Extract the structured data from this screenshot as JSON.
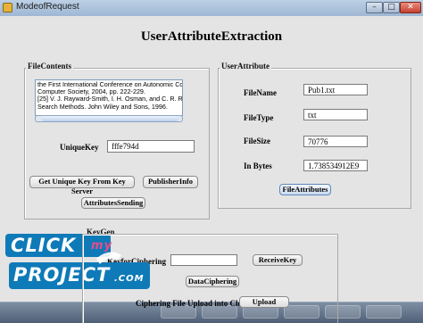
{
  "window": {
    "title": "ModeofRequest",
    "minimize": "–",
    "maximize": "□",
    "close": "✕"
  },
  "main_title": "UserAttributeExtraction",
  "file_contents": {
    "group_label": "FileContents",
    "text_lines": [
      "the First International Conference on Autonomic Computing",
      "Computer Society, 2004, pp. 222-229.",
      "[25] V. J. Rayward-Smith, I. H. Osman, and C. R. Reeves, M",
      "Search Methods. John Wiley and Sons, 1996."
    ],
    "unique_key_label": "UniqueKey",
    "unique_key_value": "fffe794d",
    "get_key_button": "Get Unique Key From Key Server",
    "publisher_info_button": "PublisherInfo",
    "attributes_sending_button": "AttributesSending"
  },
  "user_attribute": {
    "group_label": "UserAttribute",
    "file_name_label": "FileName",
    "file_name_value": "Pub1.txt",
    "file_type_label": "FileType",
    "file_type_value": "txt",
    "file_size_label": "FileSize",
    "file_size_value": "70776",
    "in_bytes_label": "In Bytes",
    "in_bytes_value": "1.738534912E9",
    "file_attributes_button": "FileAttributes"
  },
  "keygen": {
    "group_label": "KeyGen",
    "key_for_ciphering_label": "KeyforCiphering",
    "key_for_ciphering_value": "",
    "receive_key_button": "ReceiveKey",
    "data_ciphering_button": "DataCiphering",
    "upload_label": "Ciphering File Upload into Cloud",
    "upload_button": "Upload"
  },
  "watermark": {
    "line1": "CLICK",
    "line1_small": "my",
    "line2": "PROJECT",
    "line2_suffix": ".COM"
  }
}
